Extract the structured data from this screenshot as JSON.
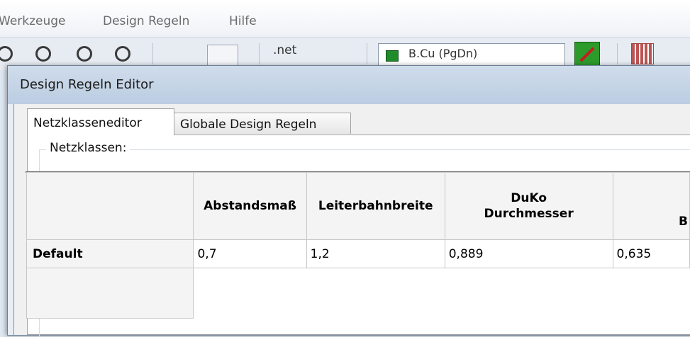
{
  "menubar": {
    "items": [
      "Werkzeuge",
      "Design Regeln",
      "Hilfe"
    ]
  },
  "toolbar": {
    "net_label": ".net",
    "layer_select_value": "B.Cu (PgDn)"
  },
  "dialog": {
    "title": "Design Regeln Editor",
    "tabs": [
      {
        "label": "Netzklasseneditor",
        "active": true
      },
      {
        "label": "Globale Design Regeln",
        "active": false
      }
    ],
    "group_label": "Netzklassen:",
    "table": {
      "headers": [
        "Abstandsmaß",
        "Leiterbahnbreite",
        "DuKo\nDurchmesser",
        "B"
      ],
      "header_lines": {
        "duko_line1": "DuKo",
        "duko_line2": "Durchmesser"
      },
      "rows": [
        {
          "name": "Default",
          "cells": [
            "0,7",
            "1,2",
            "0,889",
            "0,635"
          ]
        }
      ]
    }
  }
}
